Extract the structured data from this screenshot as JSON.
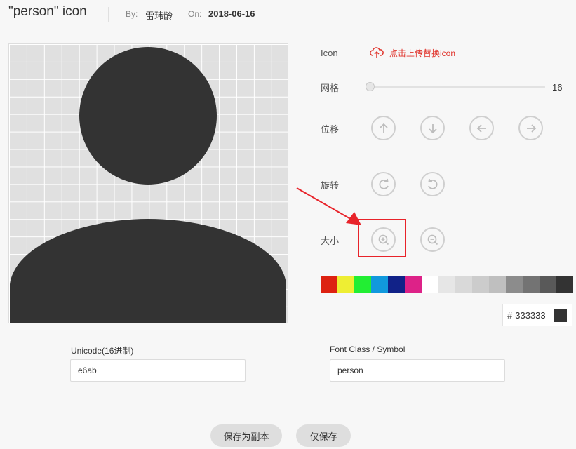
{
  "header": {
    "title": "\"person\" icon",
    "by_label": "By:",
    "author": "雷玮龄",
    "on_label": "On:",
    "date": "2018-06-16"
  },
  "controls": {
    "icon_label": "Icon",
    "upload_text": "点击上传替换icon",
    "grid_label": "网格",
    "grid_value": "16",
    "grid_level": 0,
    "move_label": "位移",
    "rotate_label": "旋转",
    "size_label": "大小"
  },
  "palette": [
    "#dd2211",
    "#eeee33",
    "#22ee33",
    "#1199dd",
    "#112288",
    "#dd2288",
    "#ffffff",
    "#e6e6e6",
    "#d9d9d9",
    "#cccccc",
    "#bfbfbf",
    "#8c8c8c",
    "#737373",
    "#595959",
    "#333333"
  ],
  "color": {
    "hash": "#",
    "value": "333333",
    "chip": "#333333"
  },
  "icon_color": "#333333",
  "fields": {
    "unicode_label": "Unicode(16进制)",
    "unicode_value": "e6ab",
    "fontclass_label": "Font Class / Symbol",
    "fontclass_value": "person"
  },
  "buttons": {
    "save_copy": "保存为副本",
    "save_only": "仅保存"
  }
}
